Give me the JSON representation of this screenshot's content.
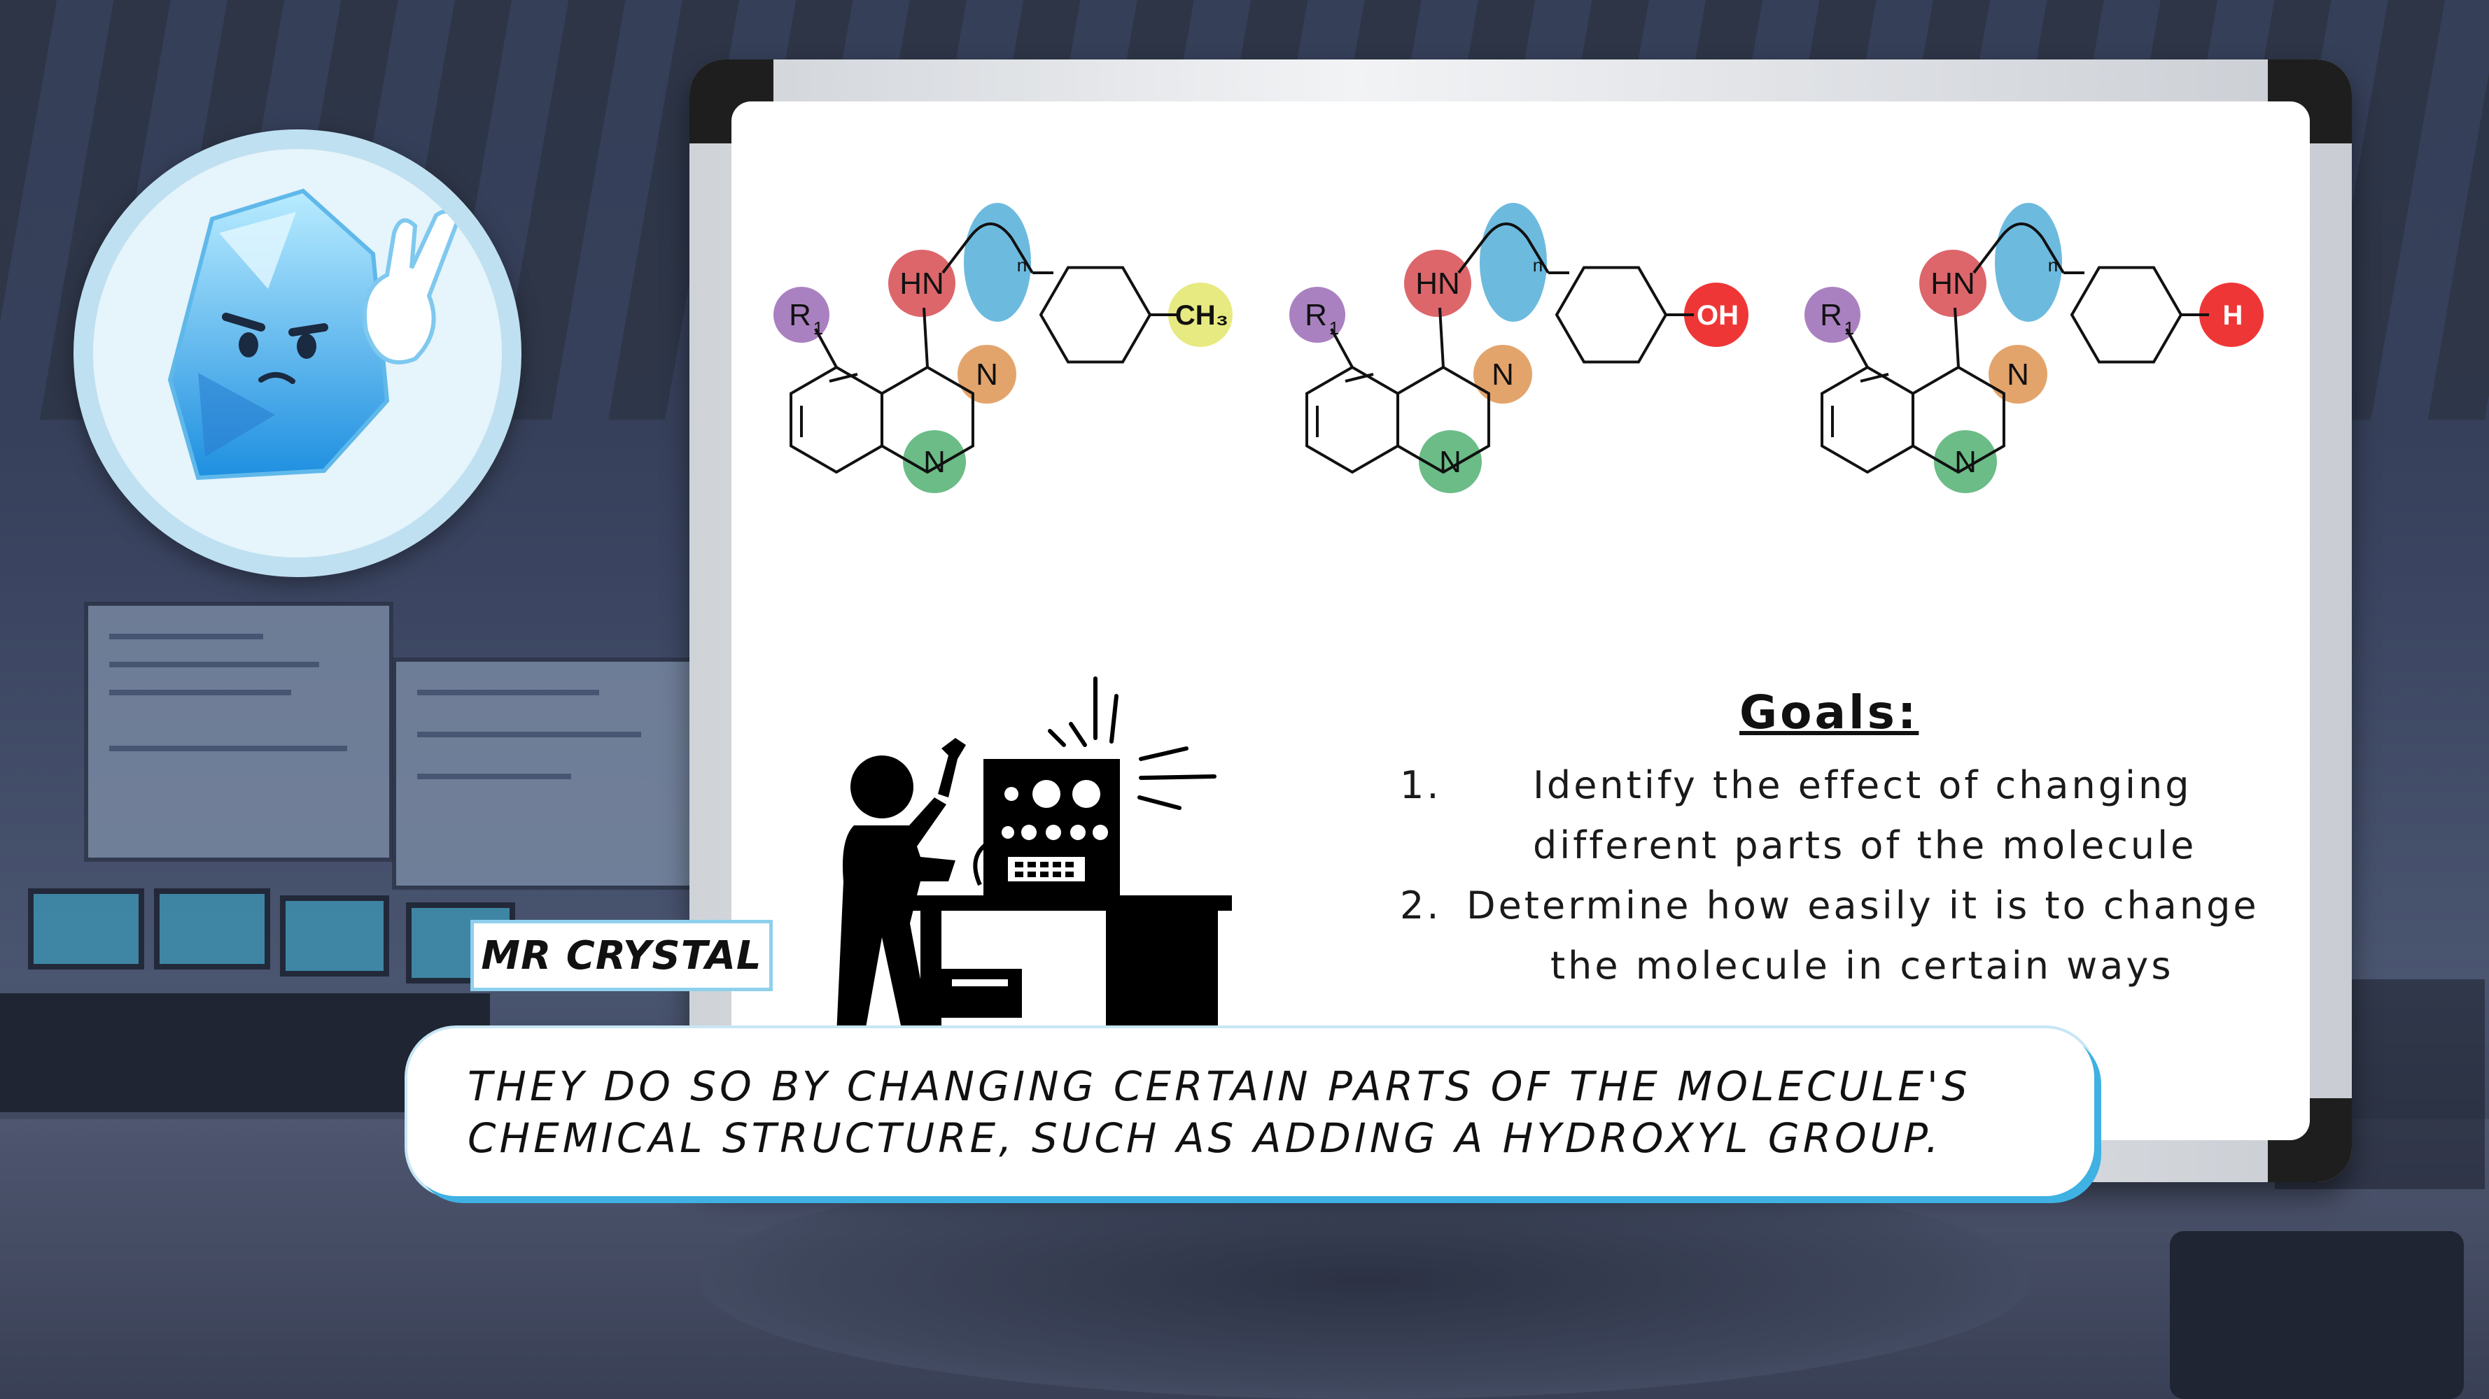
{
  "scene": {
    "background": "sci-fi laboratory",
    "accent_color": "#3fb1e3"
  },
  "character": {
    "name": "MR CRYSTAL",
    "avatar_icon": "crystal-character-icon"
  },
  "dialog": {
    "text": "They do so by changing certain parts of the molecule's chemical structure, such as adding a hydroxyl group."
  },
  "whiteboard": {
    "molecules": [
      {
        "substituent": "CH₃",
        "substituent_color": "#e6e97a"
      },
      {
        "substituent": "OH",
        "substituent_color": "#ee2b2b"
      },
      {
        "substituent": "H",
        "substituent_color": "#ee2b2b"
      }
    ],
    "labels": {
      "hn": "HN",
      "n": "N",
      "r": "R",
      "r_sub": "1",
      "chain_sub": "n"
    },
    "highlight_colors": {
      "r_group": "#9b6bb5",
      "hn_group": "#d9555a",
      "chain": "#5db3dc",
      "ring_n_top": "#e09a5c",
      "ring_n_bottom": "#5bb57a"
    },
    "goals": {
      "title": "Goals:",
      "items": [
        {
          "num": "1.",
          "line1": "Identify the effect of changing",
          "line2": "different parts of the molecule"
        },
        {
          "num": "2.",
          "line1": "Determine how easily it is to change",
          "line2": "the molecule in certain ways"
        }
      ]
    },
    "illustration_icon": "scientist-machine-icon"
  }
}
